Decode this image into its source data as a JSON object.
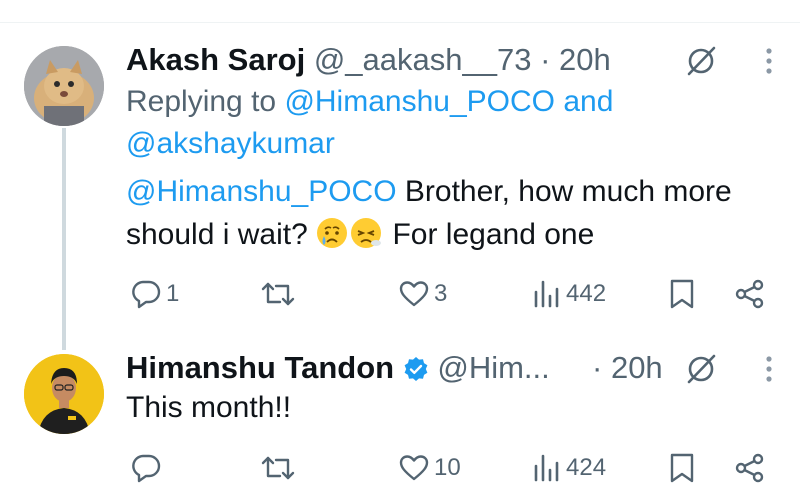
{
  "tweets": [
    {
      "name": "Akash Saroj",
      "handle": "@_aakash__73",
      "separator": "·",
      "time": "20h",
      "replying_prefix": "Replying to",
      "replying_user1": "@Himanshu_POCO",
      "replying_and": "and",
      "replying_user2": "@akshaykumar",
      "mention": "@Himanshu_POCO",
      "text_part1": " Brother, how much more",
      "text_part2": "should i wait?",
      "text_part3": "For legand one",
      "emojis": [
        "crying-face",
        "exhaling-face"
      ],
      "replies": "1",
      "retweets": "",
      "likes": "3",
      "views": "442"
    },
    {
      "name": "Himanshu Tandon",
      "verified": true,
      "handle": "@Him...",
      "separator": "·",
      "time": "20h",
      "text": "This month!!",
      "replies": "",
      "retweets": "",
      "likes": "10",
      "views": "424"
    }
  ],
  "colors": {
    "link": "#1d9bf0",
    "secondary": "#536471",
    "verified": "#1d9bf0",
    "avatar2_bg": "#f2c317"
  }
}
